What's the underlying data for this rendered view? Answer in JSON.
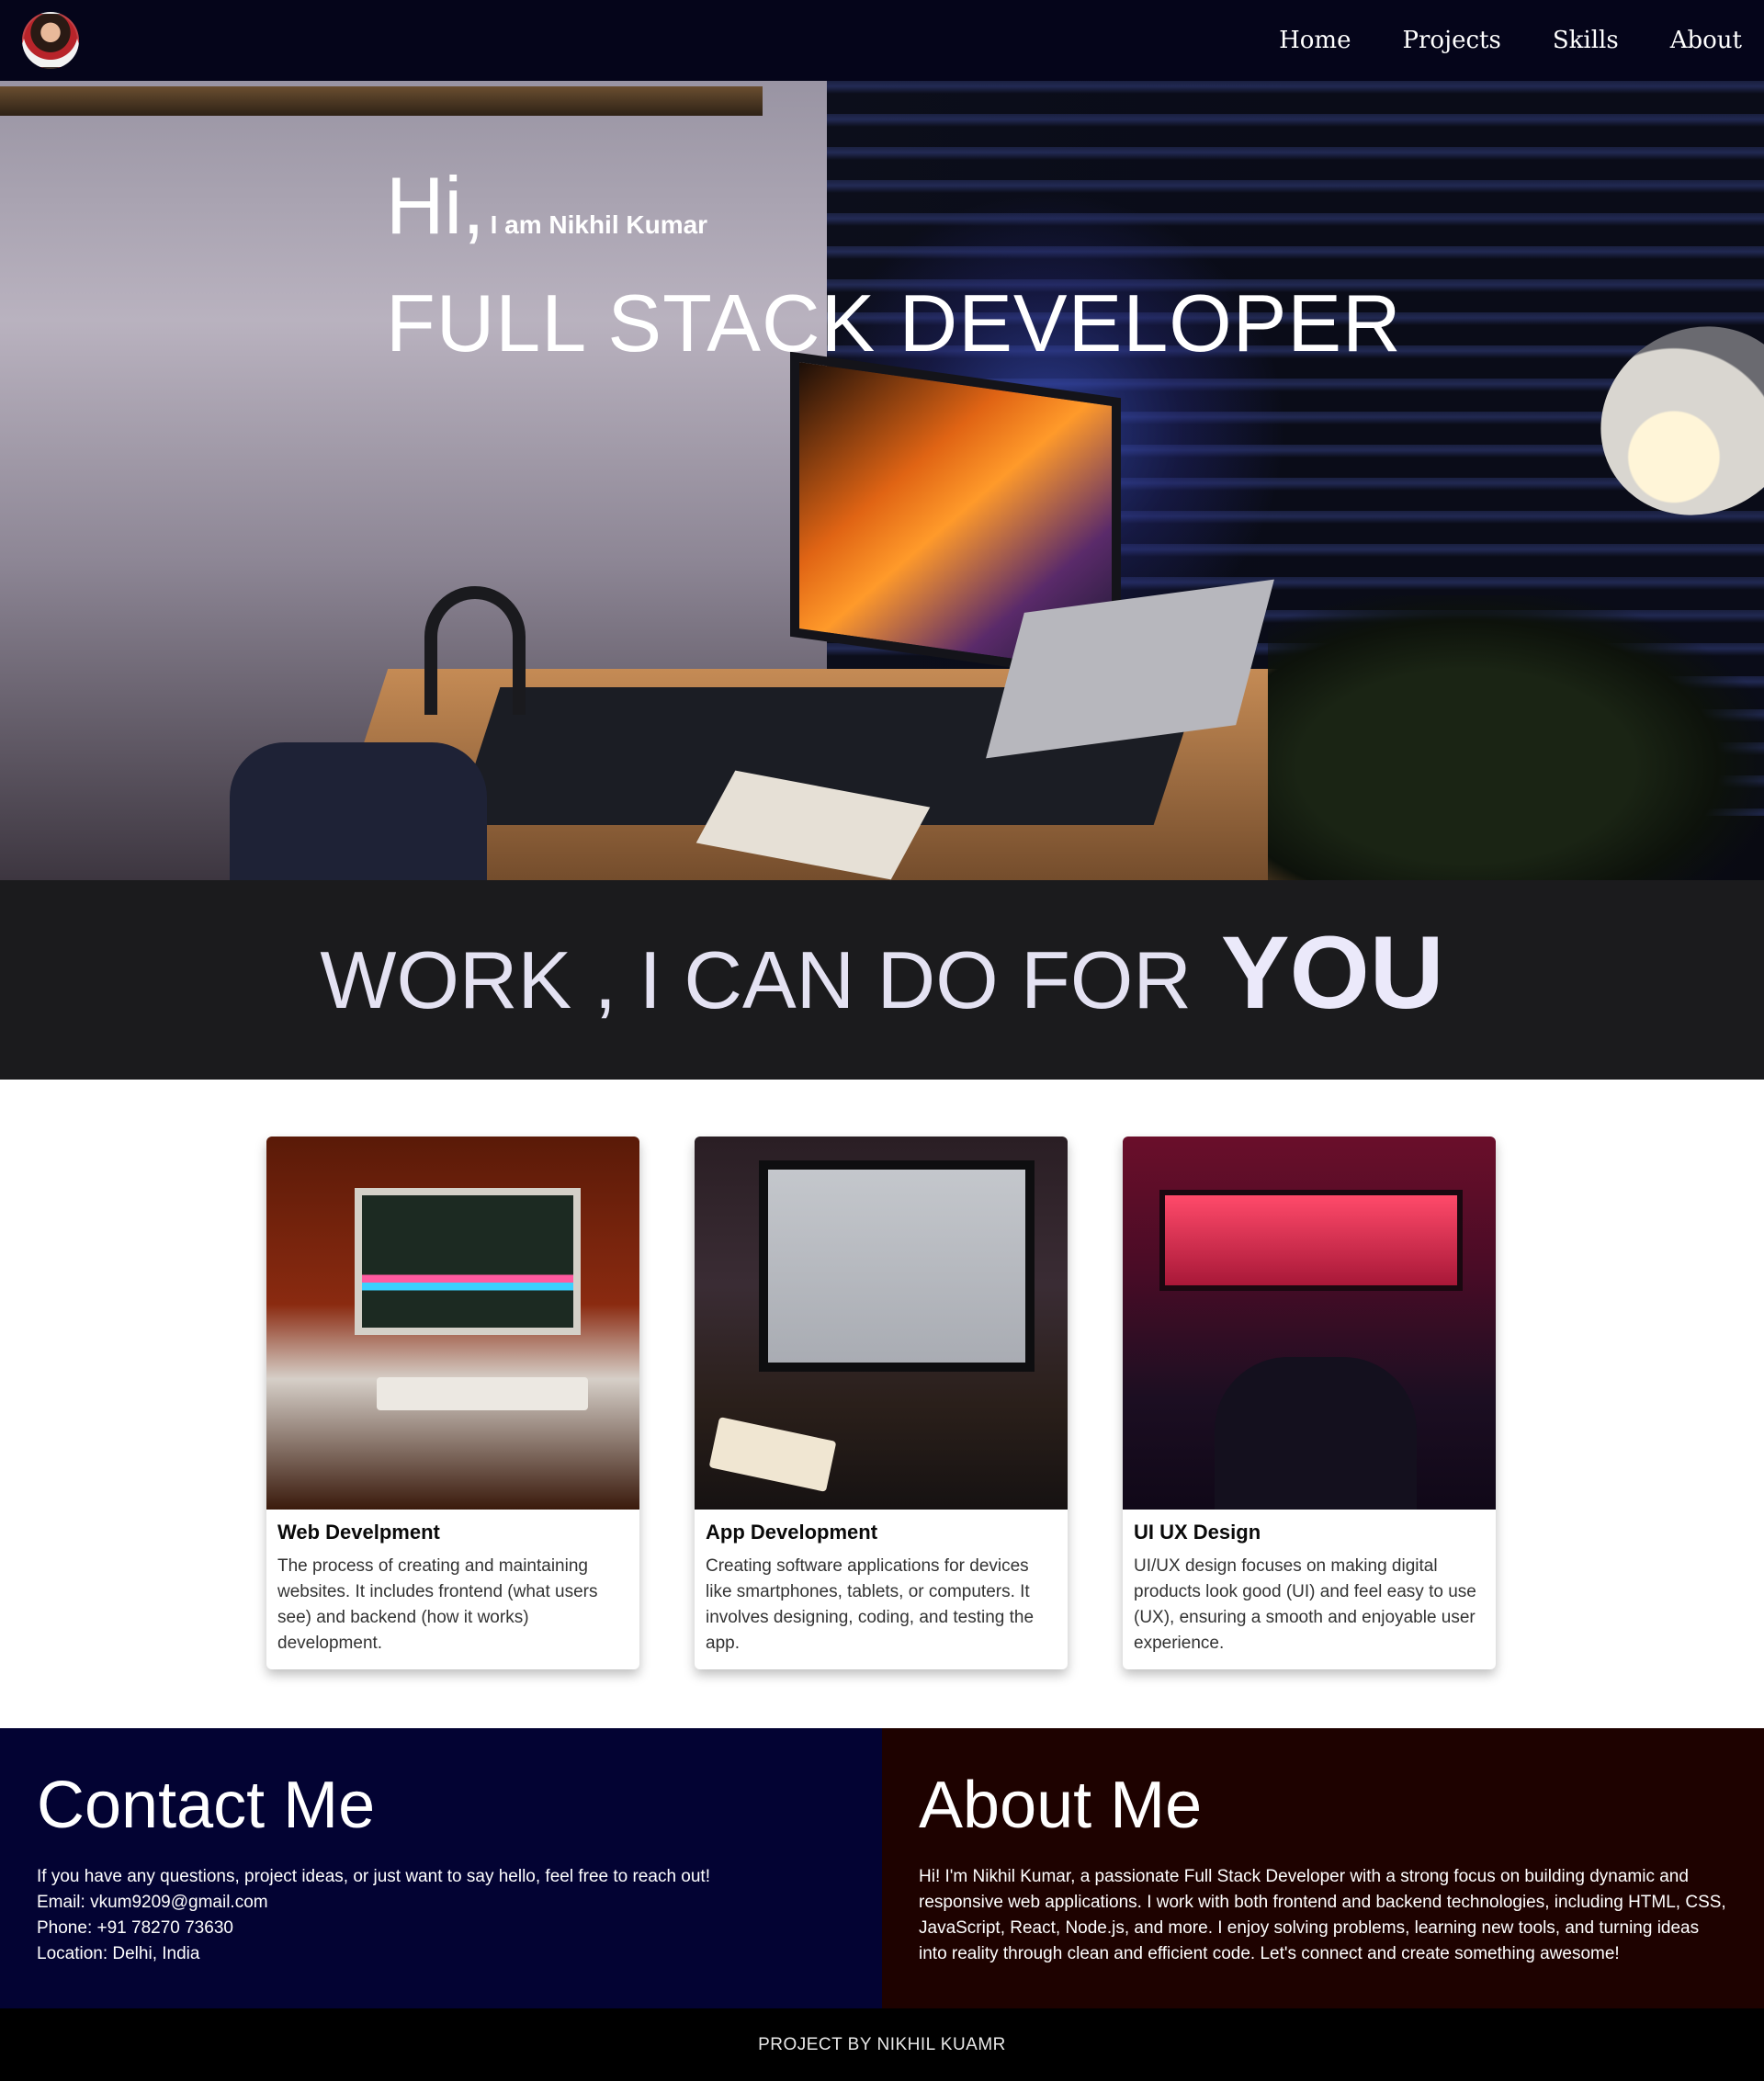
{
  "nav": {
    "links": [
      "Home",
      "Projects",
      "Skills",
      "About"
    ]
  },
  "hero": {
    "greeting": "Hi,",
    "name": "I am Nikhil Kumar",
    "role": "FULL STACK DEVELOPER"
  },
  "banner": {
    "main": "WORK , I CAN DO FOR",
    "emphasis": "YOU"
  },
  "cards": [
    {
      "title": "Web Develpment",
      "description": "The process of creating and maintaining websites. It includes frontend (what users see) and backend (how it works) development."
    },
    {
      "title": "App Development",
      "description": "Creating software applications for devices like smartphones, tablets, or computers. It involves designing, coding, and testing the app."
    },
    {
      "title": "UI UX Design",
      "description": "UI/UX design focuses on making digital products look good (UI) and feel easy to use (UX), ensuring a smooth and enjoyable user experience."
    }
  ],
  "contact": {
    "title": "Contact Me",
    "intro": "If you have any questions, project ideas, or just want to say hello, feel free to reach out!",
    "email": "Email: vkum9209@gmail.com",
    "phone": "Phone: +91 78270 73630",
    "location": "Location: Delhi, India"
  },
  "about": {
    "title": "About Me",
    "text": "Hi! I'm Nikhil Kumar, a passionate Full Stack Developer with a strong focus on building dynamic and responsive web applications. I work with both frontend and backend technologies, including HTML, CSS, JavaScript, React, Node.js, and more. I enjoy solving problems, learning new tools, and turning ideas into reality through clean and efficient code. Let's connect and create something awesome!"
  },
  "footer": {
    "text": "PROJECT BY NIKHIL KUAMR"
  },
  "colors": {
    "nav_bg": "#05051a",
    "banner_bg": "#1b1b1d",
    "contact_bg": "#030333",
    "about_bg": "#1e0200",
    "footer_bg": "#000000"
  }
}
